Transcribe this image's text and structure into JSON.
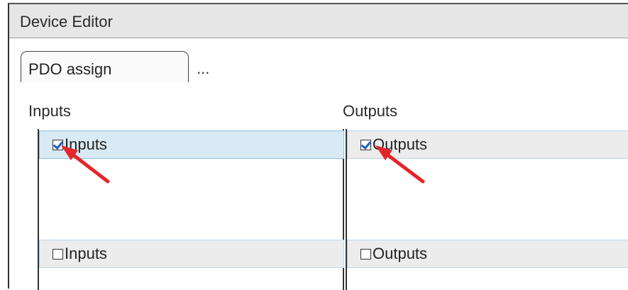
{
  "window": {
    "title": "Device Editor"
  },
  "tabs": {
    "active_label": "PDO assign",
    "more": "..."
  },
  "inputs_section": {
    "title": "Inputs",
    "rows": [
      {
        "label": "Inputs",
        "checked": true
      },
      {
        "label": "Inputs",
        "checked": false
      }
    ]
  },
  "outputs_section": {
    "title": "Outputs",
    "rows": [
      {
        "label": "Outputs",
        "checked": true
      },
      {
        "label": "Outputs",
        "checked": false
      }
    ]
  },
  "colors": {
    "annotation_arrow": "#e3262a",
    "selected_row": "#d9eaf4",
    "row_border": "#8fc2e2"
  }
}
